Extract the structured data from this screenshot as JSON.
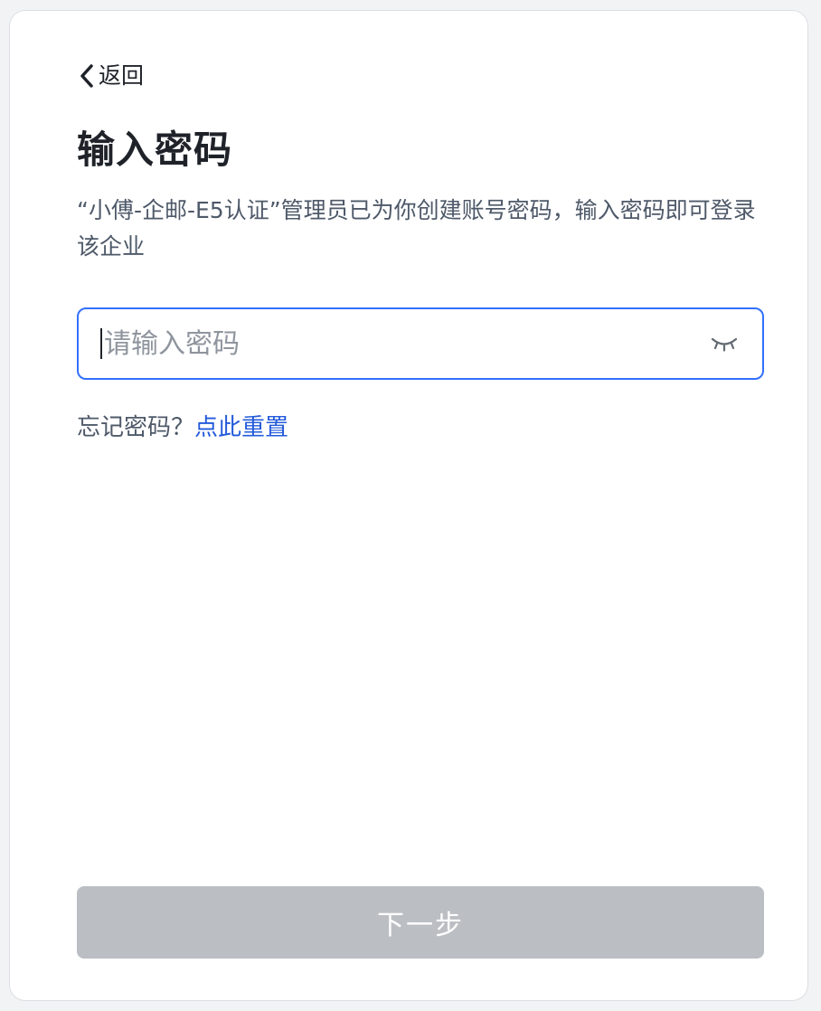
{
  "header": {
    "back_label": "返回"
  },
  "main": {
    "title": "输入密码",
    "description": "“小傅-企邮-E5认证”管理员已为你创建账号密码，输入密码即可登录该企业",
    "password": {
      "placeholder": "请输入密码",
      "value": "",
      "toggle_icon": "eye-closed-icon"
    },
    "forgot": {
      "prefix": "忘记密码？",
      "link_label": "点此重置"
    },
    "next_label": "下一步"
  },
  "colors": {
    "accent": "#3370ff",
    "link": "#245bdb",
    "button_disabled": "#bbbfc4",
    "text_primary": "#1f2329",
    "text_secondary": "#4e5969"
  }
}
